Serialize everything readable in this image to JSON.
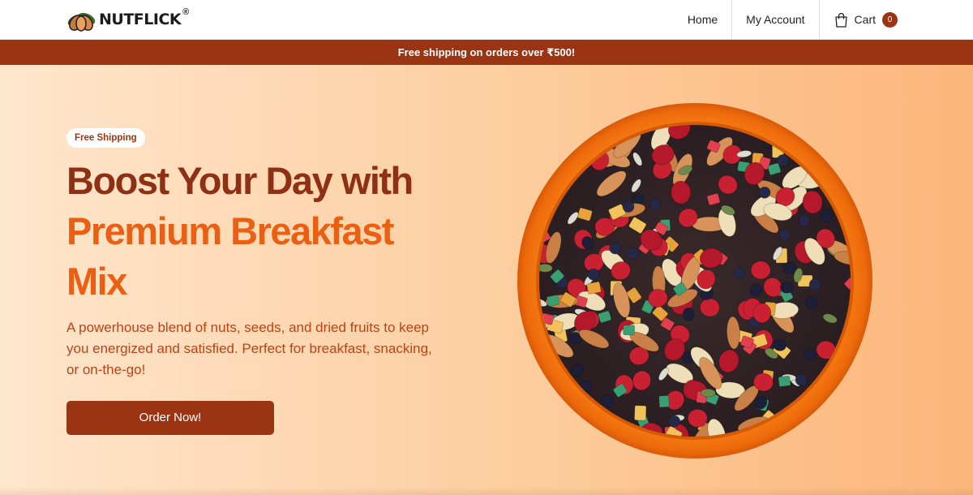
{
  "brand": {
    "name": "NUTFLICK",
    "reg_mark": "®",
    "logo_icon": "almond-leaves-logo"
  },
  "nav": {
    "home": "Home",
    "account": "My Account",
    "cart": "Cart",
    "cart_count": "0",
    "cart_icon": "shopping-bag-icon"
  },
  "promo": {
    "text": "Free shipping on orders over ₹500!"
  },
  "hero": {
    "badge": "Free Shipping",
    "headline_line1": "Boost Your Day with",
    "headline_line2": "Premium Breakfast",
    "headline_line3": "Mix",
    "description": "A powerhouse blend of nuts, seeds, and dried fruits to keep you energized and satisfied. Perfect for breakfast, snacking, or on-the-go!",
    "cta": "Order Now!",
    "image_subject": "bowl-of-breakfast-trail-mix"
  },
  "colors": {
    "brand_dark": "#9b3412",
    "accent_orange": "#ea5f12",
    "text_orange": "#b94316",
    "bowl_orange": "#ee6f10",
    "hero_gradient_start": "#fee6cd",
    "hero_gradient_end": "#fcb67a"
  }
}
